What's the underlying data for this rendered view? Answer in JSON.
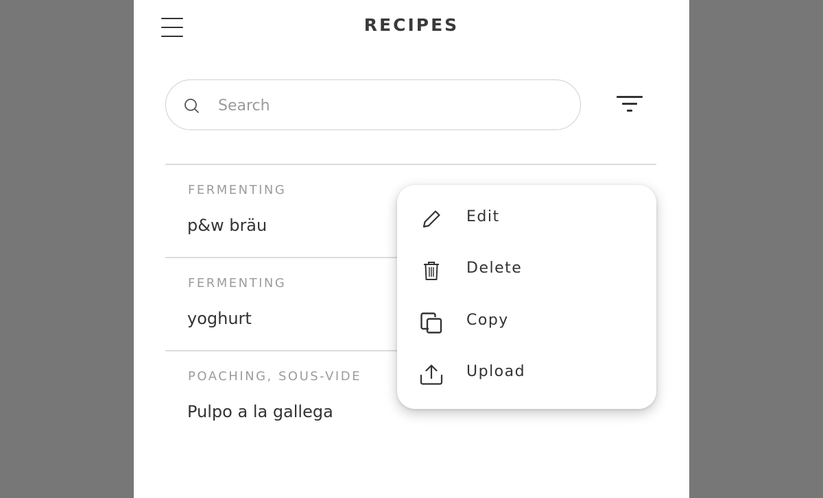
{
  "header": {
    "title": "RECIPES"
  },
  "search": {
    "placeholder": "Search",
    "value": ""
  },
  "recipes": [
    {
      "category": "FERMENTING",
      "name": "p&w bräu"
    },
    {
      "category": "FERMENTING",
      "name": "yoghurt"
    },
    {
      "category": "POACHING, SOUS-VIDE",
      "name": "Pulpo a la gallega"
    }
  ],
  "context_menu": {
    "items": [
      {
        "label": "Edit",
        "icon": "pencil-icon"
      },
      {
        "label": "Delete",
        "icon": "trash-icon"
      },
      {
        "label": "Copy",
        "icon": "copy-icon"
      },
      {
        "label": "Upload",
        "icon": "upload-icon"
      }
    ]
  }
}
